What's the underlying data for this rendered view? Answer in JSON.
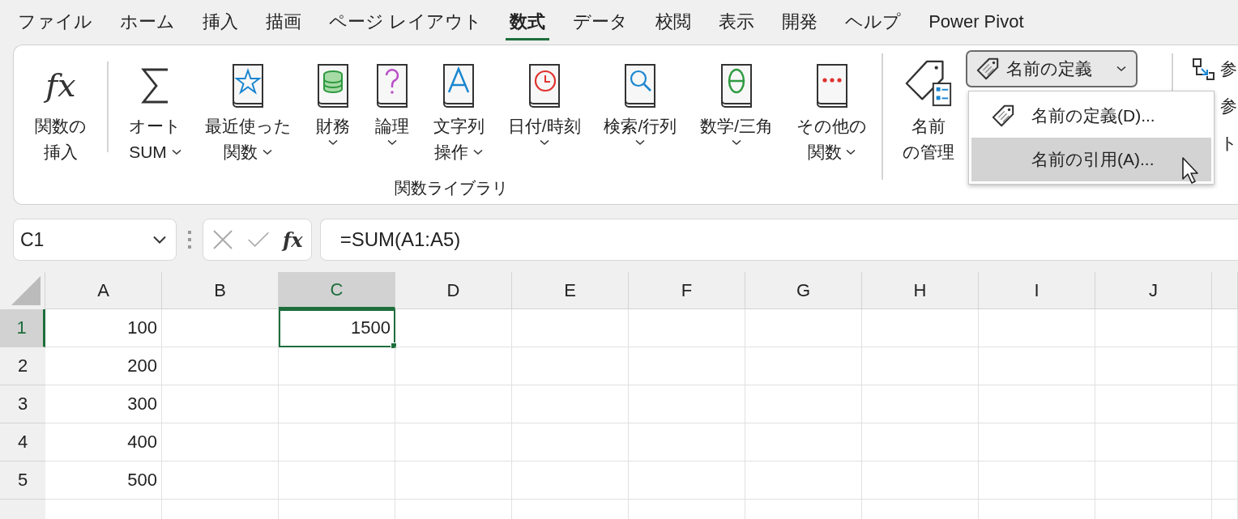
{
  "menu_tabs": [
    {
      "label": "ファイル",
      "selected": false
    },
    {
      "label": "ホーム",
      "selected": false
    },
    {
      "label": "挿入",
      "selected": false
    },
    {
      "label": "描画",
      "selected": false
    },
    {
      "label": "ページ レイアウト",
      "selected": false
    },
    {
      "label": "数式",
      "selected": true
    },
    {
      "label": "データ",
      "selected": false
    },
    {
      "label": "校閲",
      "selected": false
    },
    {
      "label": "表示",
      "selected": false
    },
    {
      "label": "開発",
      "selected": false
    },
    {
      "label": "ヘルプ",
      "selected": false
    },
    {
      "label": "Power Pivot",
      "selected": false
    }
  ],
  "ribbon": {
    "function_library": {
      "label": "関数ライブラリ",
      "buttons": [
        {
          "kind": "symbol",
          "symbol": "fx",
          "lines": [
            "関数の",
            "挿入"
          ],
          "dropdown": false
        },
        {
          "kind": "sigma",
          "lines": [
            "オート",
            "SUM"
          ],
          "dropdown": true
        },
        {
          "kind": "star",
          "lines": [
            "最近使った",
            "関数"
          ],
          "dropdown": true
        },
        {
          "kind": "coins",
          "lines": [
            "財務"
          ],
          "dropdown": true
        },
        {
          "kind": "question",
          "lines": [
            "論理"
          ],
          "dropdown": true
        },
        {
          "kind": "letter",
          "lines": [
            "文字列",
            "操作"
          ],
          "dropdown": true
        },
        {
          "kind": "clock",
          "lines": [
            "日付/時刻"
          ],
          "dropdown": true
        },
        {
          "kind": "magnifier",
          "lines": [
            "検索/行列"
          ],
          "dropdown": true
        },
        {
          "kind": "theta",
          "lines": [
            "数学/三角"
          ],
          "dropdown": true
        },
        {
          "kind": "dots",
          "lines": [
            "その他の",
            "関数"
          ],
          "dropdown": true
        }
      ]
    },
    "defined_names": {
      "manager": {
        "lines": [
          "名前",
          "の管理"
        ]
      },
      "define_button": {
        "label": "名前の定義",
        "expanded": true
      },
      "menu": [
        {
          "label": "名前の定義(D)...",
          "selected": false,
          "kind": "tagged"
        },
        {
          "label": "名前の引用(A)...",
          "selected": true,
          "kind": "plain"
        }
      ]
    },
    "formula_auditing": [
      {
        "kind": "precedents",
        "label": "参"
      },
      {
        "kind": "dependents",
        "label": "参"
      },
      {
        "kind": "remove",
        "label": "ト"
      }
    ]
  },
  "formula_bar": {
    "name_box": "C1",
    "function_symbol": "fx",
    "formula": "=SUM(A1:A5)"
  },
  "sheet": {
    "columns": [
      {
        "label": "A",
        "selected": false
      },
      {
        "label": "B",
        "selected": false
      },
      {
        "label": "C",
        "selected": true
      },
      {
        "label": "D",
        "selected": false
      },
      {
        "label": "E",
        "selected": false
      },
      {
        "label": "F",
        "selected": false
      },
      {
        "label": "G",
        "selected": false
      },
      {
        "label": "H",
        "selected": false
      },
      {
        "label": "I",
        "selected": false
      },
      {
        "label": "J",
        "selected": false
      }
    ],
    "rows": [
      {
        "label": "1",
        "selected": true,
        "cells": [
          {
            "text": "100",
            "selected": false
          },
          {
            "selected": false
          },
          {
            "text": "1500",
            "selected": true
          }
        ]
      },
      {
        "label": "2",
        "selected": false,
        "cells": [
          {
            "text": "200",
            "selected": false
          }
        ]
      },
      {
        "label": "3",
        "selected": false,
        "cells": [
          {
            "text": "300",
            "selected": false
          }
        ]
      },
      {
        "label": "4",
        "selected": false,
        "cells": [
          {
            "text": "400",
            "selected": false
          }
        ]
      },
      {
        "label": "5",
        "selected": false,
        "cells": [
          {
            "text": "500",
            "selected": false
          }
        ]
      },
      {
        "selected": false,
        "cells": []
      }
    ]
  }
}
